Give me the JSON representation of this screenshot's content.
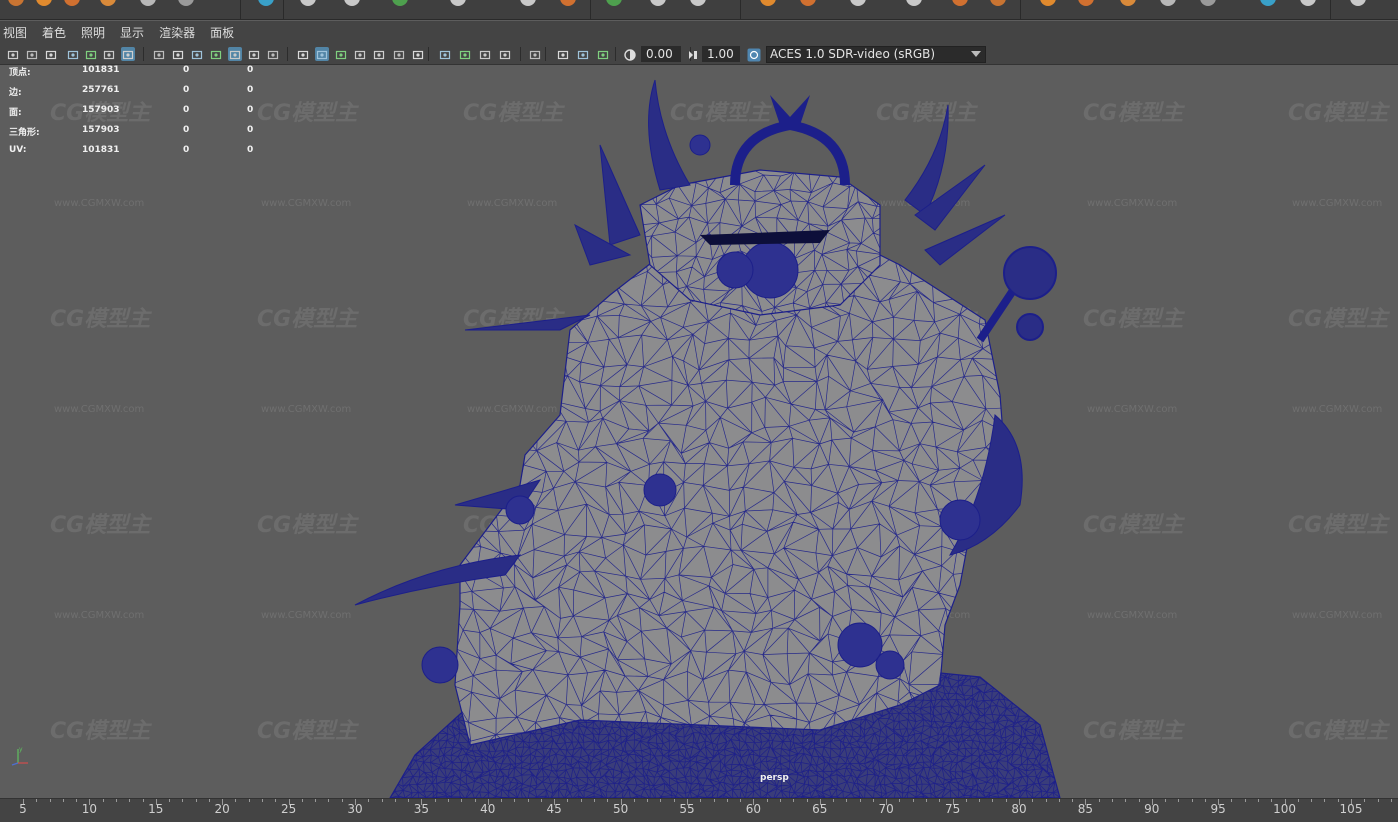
{
  "menu": [
    "视图",
    "着色",
    "照明",
    "显示",
    "渲染器",
    "面板"
  ],
  "toolbar": {
    "exposure_value": "0.00",
    "gamma_value": "1.00",
    "color_space": "ACES 1.0 SDR-video (sRGB)",
    "icons": [
      "select-camera-icon",
      "camera-attributes-icon",
      "bookmark-icon",
      "image-plane-icon",
      "grid-icon",
      "film-gate-icon",
      "resolution-gate-icon",
      "gate-mask-icon",
      "field-chart-icon",
      "safe-action-icon",
      "safe-title-icon",
      "wireframe-icon",
      "smooth-shade-icon",
      "default-material-icon",
      "wireframe-on-shaded-icon",
      "xray-icon",
      "use-all-lights-icon",
      "shadows-icon",
      "ambient-occlusion-icon",
      "isolate-select-icon",
      "xray-joints-icon",
      "xray-active-icon",
      "screen-space-ao-icon",
      "motion-blur-icon",
      "anti-aliasing-icon",
      "depth-of-field-icon",
      "exposure-icon",
      "gamma-icon",
      "color-management-icon"
    ]
  },
  "hud": {
    "rows": [
      {
        "label": "顶点:",
        "v1": "101831",
        "v2": "0",
        "v3": "0"
      },
      {
        "label": "边:",
        "v1": "257761",
        "v2": "0",
        "v3": "0"
      },
      {
        "label": "面:",
        "v1": "157903",
        "v2": "0",
        "v3": "0"
      },
      {
        "label": "三角形:",
        "v1": "157903",
        "v2": "0",
        "v3": "0"
      },
      {
        "label": "UV:",
        "v1": "101831",
        "v2": "0",
        "v3": "0"
      }
    ],
    "camera": "persp"
  },
  "watermark": {
    "logo": "CG模型主",
    "url": "www.CGMXW.com"
  },
  "timeline": {
    "labels": [
      "5",
      "10",
      "15",
      "20",
      "25",
      "30",
      "35",
      "40",
      "45",
      "50",
      "55",
      "60",
      "65",
      "70",
      "75",
      "80",
      "85",
      "90",
      "95",
      "100",
      "105"
    ]
  },
  "colors": {
    "wire": "#1c1f8a",
    "mesh_fill": "#8c8c8e",
    "viewport_bg": "#5d5d5d",
    "active_icon": "#5285a6"
  }
}
